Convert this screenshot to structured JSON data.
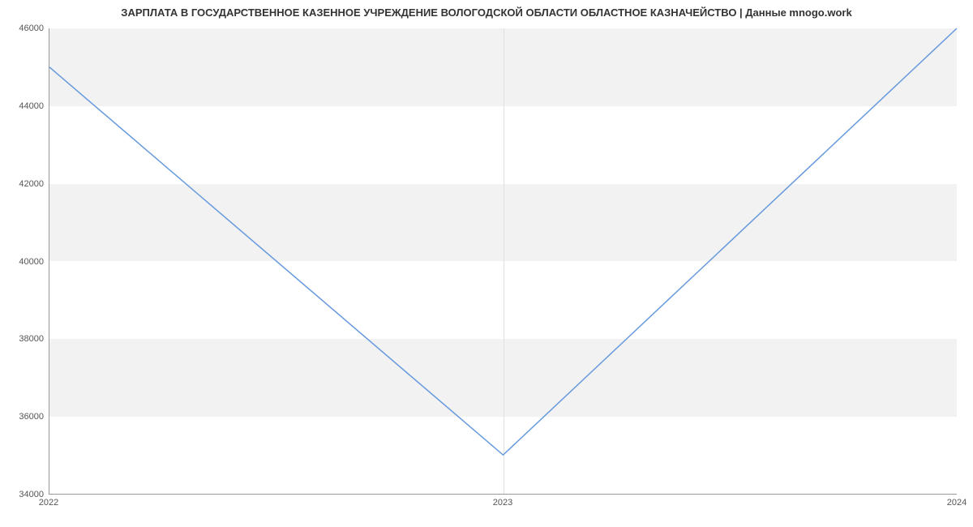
{
  "chart_data": {
    "type": "line",
    "title": "ЗАРПЛАТА В ГОСУДАРСТВЕННОЕ КАЗЕННОЕ УЧРЕЖДЕНИЕ ВОЛОГОДСКОЙ ОБЛАСТИ ОБЛАСТНОЕ КАЗНАЧЕЙСТВО | Данные mnogo.work",
    "x": [
      "2022",
      "2023",
      "2024"
    ],
    "values": [
      45000,
      35000,
      46000
    ],
    "xlabel": "",
    "ylabel": "",
    "ylim": [
      34000,
      46000
    ],
    "yticks": [
      34000,
      36000,
      38000,
      40000,
      42000,
      44000,
      46000
    ],
    "xticks": [
      "2022",
      "2023",
      "2024"
    ],
    "line_color": "#6699dd"
  }
}
